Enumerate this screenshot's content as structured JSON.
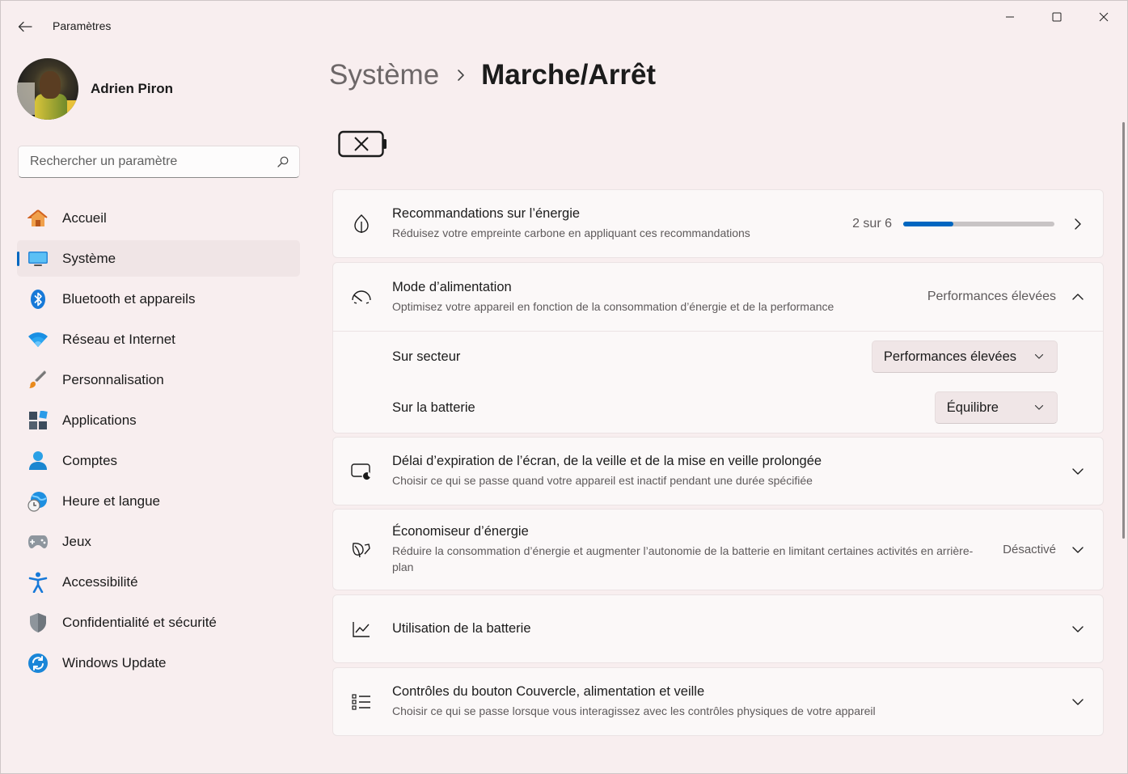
{
  "window": {
    "title": "Paramètres",
    "controls": {
      "minimize": "minimize-icon",
      "maximize": "maximize-icon",
      "close": "close-icon"
    }
  },
  "profile": {
    "name": "Adrien Piron"
  },
  "search": {
    "placeholder": "Rechercher un paramètre",
    "value": ""
  },
  "sidebar": {
    "items": [
      {
        "label": "Accueil",
        "icon": "home-icon",
        "active": false
      },
      {
        "label": "Système",
        "icon": "system-icon",
        "active": true
      },
      {
        "label": "Bluetooth et appareils",
        "icon": "bluetooth-icon",
        "active": false
      },
      {
        "label": "Réseau et Internet",
        "icon": "wifi-icon",
        "active": false
      },
      {
        "label": "Personnalisation",
        "icon": "brush-icon",
        "active": false
      },
      {
        "label": "Applications",
        "icon": "apps-icon",
        "active": false
      },
      {
        "label": "Comptes",
        "icon": "account-icon",
        "active": false
      },
      {
        "label": "Heure et langue",
        "icon": "time-language-icon",
        "active": false
      },
      {
        "label": "Jeux",
        "icon": "gamepad-icon",
        "active": false
      },
      {
        "label": "Accessibilité",
        "icon": "accessibility-icon",
        "active": false
      },
      {
        "label": "Confidentialité et sécurité",
        "icon": "shield-icon",
        "active": false
      },
      {
        "label": "Windows Update",
        "icon": "update-icon",
        "active": false
      }
    ]
  },
  "breadcrumb": {
    "parent": "Système",
    "current": "Marche/Arrêt"
  },
  "main": {
    "energy_recommendations": {
      "title": "Recommandations sur l’énergie",
      "description": "Réduisez votre empreinte carbone en appliquant ces recommandations",
      "progress_text": "2 sur 6",
      "progress_done": 2,
      "progress_total": 6
    },
    "power_mode": {
      "title": "Mode d’alimentation",
      "description": "Optimisez votre appareil en fonction de la consommation d’énergie et de la performance",
      "value": "Performances élevées",
      "plugged_in": {
        "label": "Sur secteur",
        "value": "Performances élevées"
      },
      "on_battery": {
        "label": "Sur la batterie",
        "value": "Équilibre"
      }
    },
    "screen_sleep": {
      "title": "Délai d’expiration de l’écran, de la veille et de la mise en veille prolongée",
      "description": "Choisir ce qui se passe quand votre appareil est inactif pendant une durée spécifiée"
    },
    "energy_saver": {
      "title": "Économiseur d’énergie",
      "description": "Réduire la consommation d’énergie et augmenter l’autonomie de la batterie en limitant certaines activités en arrière-plan",
      "value": "Désactivé"
    },
    "battery_usage": {
      "title": "Utilisation de la batterie"
    },
    "lid_power_controls": {
      "title": "Contrôles du bouton Couvercle, alimentation et veille",
      "description": "Choisir ce qui se passe lorsque vous interagissez avec les contrôles physiques de votre appareil"
    }
  },
  "colors": {
    "accent": "#0067c0",
    "background": "#f8eeef",
    "card": "#fbf8f8"
  }
}
